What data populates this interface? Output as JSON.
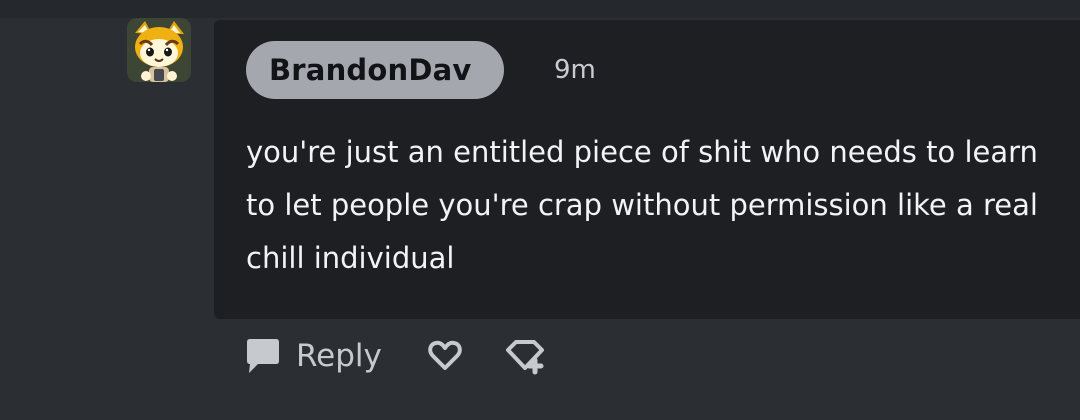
{
  "comment": {
    "username": "BrandonDav",
    "timestamp": "9m",
    "body": "you're just an entitled piece of shit who needs to learn to let people you're crap without permission like a real chill individual",
    "avatar_icon": "red-panda-avatar-icon"
  },
  "actions": {
    "reply_label": "Reply",
    "reply_icon": "speech-bubble-icon",
    "like_icon": "heart-icon",
    "award_icon": "award-plus-icon"
  },
  "colors": {
    "background": "#2b2e33",
    "card": "#1d1f23",
    "username_pill": "#a4a7ad",
    "text": "#f2f3f5",
    "muted": "#c6c9ce"
  }
}
